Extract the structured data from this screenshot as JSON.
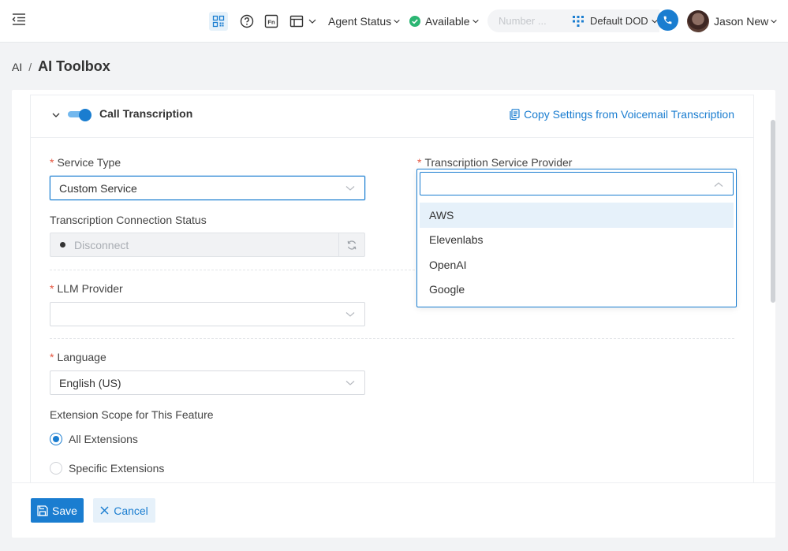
{
  "topbar": {
    "agent_status": "Agent Status",
    "availability": "Available",
    "number_placeholder": "Number ...",
    "dod_label": "Default DOD",
    "user_name": "Jason New",
    "icons": [
      "menu-collapse-icon",
      "qr-code-icon",
      "help-icon",
      "fn-key-icon",
      "window-icon",
      "dialpad-icon",
      "phone-icon"
    ],
    "colors": {
      "accent": "#1a7dd0",
      "available": "#2bb673"
    }
  },
  "breadcrumb": {
    "root": "AI",
    "separator": "/",
    "title": "AI Toolbox"
  },
  "card": {
    "title": "Call Transcription",
    "toggle_on": true,
    "copy_link": "Copy Settings from Voicemail Transcription"
  },
  "form": {
    "required_mark": "*",
    "service_type": {
      "label": "Service Type",
      "value": "Custom Service"
    },
    "provider": {
      "label": "Transcription Service Provider",
      "value": "",
      "options": [
        "AWS",
        "Elevenlabs",
        "OpenAI",
        "Google"
      ],
      "highlighted": "AWS"
    },
    "connection_status": {
      "label": "Transcription Connection Status",
      "value": "Disconnect"
    },
    "llm_provider": {
      "label": "LLM Provider",
      "value": ""
    },
    "language": {
      "label": "Language",
      "value": "English (US)"
    },
    "extension_scope": {
      "label": "Extension Scope for This Feature",
      "options": [
        "All Extensions",
        "Specific Extensions"
      ],
      "selected": "All Extensions"
    }
  },
  "footer": {
    "save": "Save",
    "cancel": "Cancel"
  }
}
